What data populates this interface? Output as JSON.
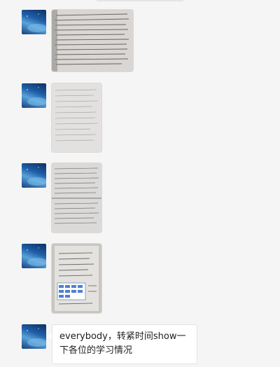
{
  "chat": {
    "messages": [
      {
        "type": "image",
        "sender_avatar": "starry-sky-avatar",
        "content": "photo of handwritten notes page"
      },
      {
        "type": "image",
        "sender_avatar": "starry-sky-avatar",
        "content": "photo of handwritten notes page"
      },
      {
        "type": "image",
        "sender_avatar": "starry-sky-avatar",
        "content": "photo of open notebook with handwritten notes"
      },
      {
        "type": "image",
        "sender_avatar": "starry-sky-avatar",
        "content": "photo of printed page with blue table"
      },
      {
        "type": "text",
        "sender_avatar": "starry-sky-avatar",
        "line1": "everybody，转紧时间show一",
        "line2": "下各位的学习情况"
      }
    ]
  },
  "colors": {
    "background": "#f5f5f5",
    "bubble": "#ffffff",
    "text": "#1e1e1e",
    "avatar_accent": "#1f5fa8"
  }
}
